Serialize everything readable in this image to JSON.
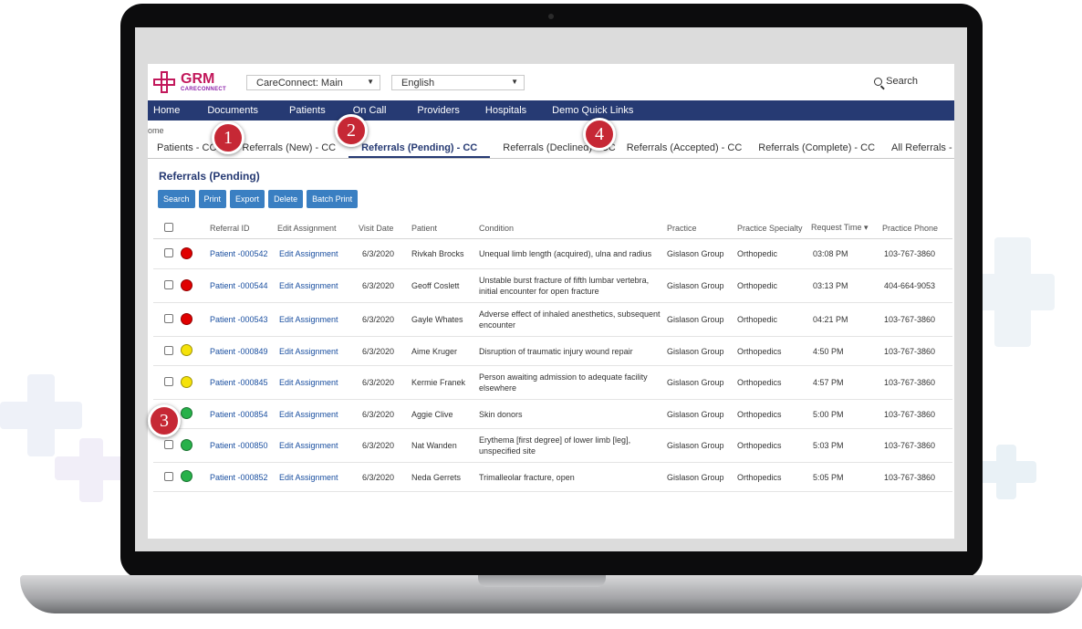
{
  "brand": {
    "name": "GRM",
    "sub": "CARECONNECT"
  },
  "selects": {
    "portal": "CareConnect: Main",
    "language": "English"
  },
  "search": {
    "label": "Search"
  },
  "nav": [
    "Home",
    "Documents",
    "Patients",
    "On Call",
    "Providers",
    "Hospitals",
    "Demo Quick Links"
  ],
  "breadcrumb": "ome",
  "tabs": [
    {
      "label": "Patients - CC",
      "active": false
    },
    {
      "label": "Referrals (New) - CC",
      "active": false
    },
    {
      "label": "Referrals (Pending) - CC",
      "active": true
    },
    {
      "label": "Referrals (Declined) - CC",
      "active": false
    },
    {
      "label": "Referrals (Accepted) - CC",
      "active": false
    },
    {
      "label": "Referrals (Complete) - CC",
      "active": false
    },
    {
      "label": "All Referrals - CC",
      "active": false
    }
  ],
  "section_title": "Referrals (Pending)",
  "actions": [
    "Search",
    "Print",
    "Export",
    "Delete",
    "Batch Print"
  ],
  "columns": [
    "Referral ID",
    "Edit Assignment",
    "Visit Date",
    "Patient",
    "Condition",
    "Practice",
    "Practice Specialty",
    "Request Time",
    "Practice Phone"
  ],
  "sort_indicator": "▾",
  "status_colors": {
    "red": "#e00000",
    "yellow": "#f5e20a",
    "green": "#27b14a"
  },
  "rows": [
    {
      "status": "red",
      "id": "Patient -000542",
      "edit": "Edit Assignment",
      "visit": "6/3/2020",
      "patient": "Rivkah Brocks",
      "condition": "Unequal limb length (acquired), ulna and radius",
      "practice": "Gislason Group",
      "specialty": "Orthopedic",
      "time": "03:08 PM",
      "phone": "103-767-3860"
    },
    {
      "status": "red",
      "id": "Patient -000544",
      "edit": "Edit Assignment",
      "visit": "6/3/2020",
      "patient": "Geoff Coslett",
      "condition": "Unstable burst fracture of fifth lumbar vertebra, initial encounter for open fracture",
      "practice": "Gislason Group",
      "specialty": "Orthopedic",
      "time": "03:13 PM",
      "phone": "404-664-9053"
    },
    {
      "status": "red",
      "id": "Patient -000543",
      "edit": "Edit Assignment",
      "visit": "6/3/2020",
      "patient": "Gayle Whates",
      "condition": "Adverse effect of inhaled anesthetics, subsequent encounter",
      "practice": "Gislason Group",
      "specialty": "Orthopedic",
      "time": "04:21 PM",
      "phone": "103-767-3860"
    },
    {
      "status": "yellow",
      "id": "Patient -000849",
      "edit": "Edit Assignment",
      "visit": "6/3/2020",
      "patient": "Aime Kruger",
      "condition": "Disruption of traumatic injury wound repair",
      "practice": "Gislason Group",
      "specialty": "Orthopedics",
      "time": "4:50 PM",
      "phone": "103-767-3860"
    },
    {
      "status": "yellow",
      "id": "Patient -000845",
      "edit": "Edit Assignment",
      "visit": "6/3/2020",
      "patient": "Kermie Franek",
      "condition": "Person awaiting admission to adequate facility elsewhere",
      "practice": "Gislason Group",
      "specialty": "Orthopedics",
      "time": "4:57 PM",
      "phone": "103-767-3860"
    },
    {
      "status": "green",
      "id": "Patient -000854",
      "edit": "Edit Assignment",
      "visit": "6/3/2020",
      "patient": "Aggie Clive",
      "condition": "Skin donors",
      "practice": "Gislason Group",
      "specialty": "Orthopedics",
      "time": "5:00 PM",
      "phone": "103-767-3860"
    },
    {
      "status": "green",
      "id": "Patient -000850",
      "edit": "Edit Assignment",
      "visit": "6/3/2020",
      "patient": "Nat Wanden",
      "condition": "Erythema [first degree] of lower limb [leg], unspecified site",
      "practice": "Gislason Group",
      "specialty": "Orthopedics",
      "time": "5:03 PM",
      "phone": "103-767-3860"
    },
    {
      "status": "green",
      "id": "Patient -000852",
      "edit": "Edit Assignment",
      "visit": "6/3/2020",
      "patient": "Neda Gerrets",
      "condition": "Trimalleolar fracture, open",
      "practice": "Gislason Group",
      "specialty": "Orthopedics",
      "time": "5:05 PM",
      "phone": "103-767-3860"
    }
  ],
  "callouts": [
    "1",
    "2",
    "3",
    "4"
  ]
}
